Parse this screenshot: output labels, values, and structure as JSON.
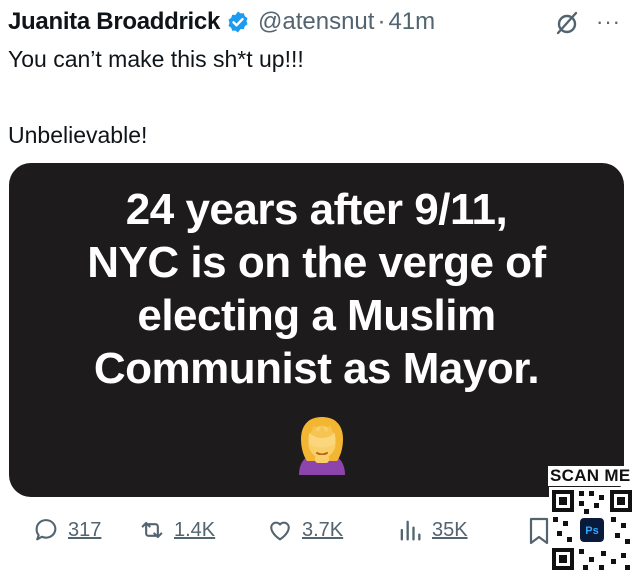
{
  "tweet": {
    "author_name": "Juanita Broaddrick",
    "handle": "@atensnut",
    "separator": "·",
    "time": "41m",
    "text_lines": [
      "You can’t make this sh*t up!!!",
      "Unbelievable!"
    ]
  },
  "media": {
    "headline_lines": [
      "24 years after 9/11,",
      "NYC is on the verge of",
      "electing a Muslim",
      "Communist as Mayor."
    ],
    "emoji": "person-facepalming-emoji"
  },
  "actions": {
    "replies": "317",
    "reposts": "1.4K",
    "likes": "3.7K",
    "views": "35K"
  },
  "overlay": {
    "scan_label": "SCAN ME",
    "qr_center_text": "Ps"
  },
  "colors": {
    "verified": "#1d9bf0",
    "secondary_text": "#536471",
    "media_bg": "#1d1b1c",
    "emoji_hair": "#f2b632",
    "emoji_shirt": "#8e44ad"
  }
}
